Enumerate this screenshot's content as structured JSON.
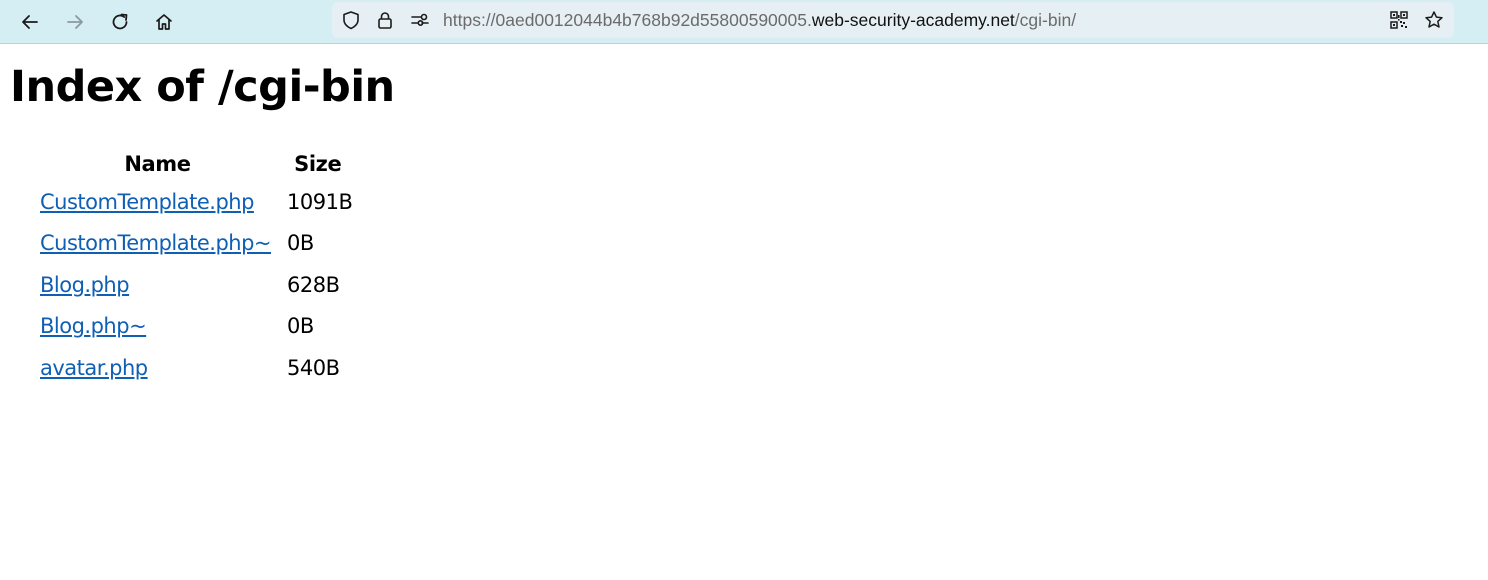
{
  "browser": {
    "url_scheme": "https://",
    "url_subdomain": "0aed0012044b4b768b92d55800590005.",
    "url_host": "web-security-academy.net",
    "url_path": "/cgi-bin/",
    "icons": [
      "back-icon",
      "forward-icon",
      "reload-icon",
      "home-icon",
      "shield-icon",
      "lock-icon",
      "permissions-icon",
      "qr-code-icon",
      "bookmark-star-icon"
    ]
  },
  "page": {
    "title": "Index of /cgi-bin",
    "columns": {
      "name": "Name",
      "size": "Size"
    },
    "files": [
      {
        "name": "CustomTemplate.php",
        "size": "1091B"
      },
      {
        "name": "CustomTemplate.php~",
        "size": "0B"
      },
      {
        "name": "Blog.php",
        "size": "628B"
      },
      {
        "name": "Blog.php~",
        "size": "0B"
      },
      {
        "name": "avatar.php",
        "size": "540B"
      }
    ]
  },
  "colors": {
    "toolbar_bg": "#d4eef3",
    "urlbar_bg": "#e6f0f4",
    "link": "#0f5fb5"
  }
}
